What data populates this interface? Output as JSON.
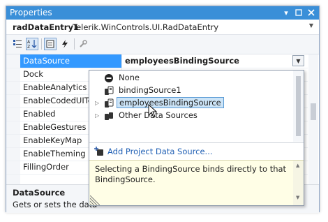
{
  "window": {
    "title": "Properties"
  },
  "object_selector": {
    "name": "radDataEntry1",
    "type": "Telerik.WinControls.UI.RadDataEntry"
  },
  "toolbar": {
    "buttons": [
      "categorized-icon",
      "alphabetical-icon",
      "properties-icon",
      "events-icon",
      "property-pages-icon"
    ]
  },
  "properties": [
    {
      "name": "DataSource",
      "value": "employeesBindingSource"
    },
    {
      "name": "Dock",
      "value": ""
    },
    {
      "name": "EnableAnalytics",
      "value": ""
    },
    {
      "name": "EnableCodedUITe",
      "value": ""
    },
    {
      "name": "Enabled",
      "value": ""
    },
    {
      "name": "EnableGestures",
      "value": ""
    },
    {
      "name": "EnableKeyMap",
      "value": ""
    },
    {
      "name": "EnableTheming",
      "value": ""
    },
    {
      "name": "FillingOrder",
      "value": ""
    }
  ],
  "dropdown": {
    "items": [
      {
        "label": "None"
      },
      {
        "label": "bindingSource1"
      },
      {
        "label": "employeesBindingSource"
      },
      {
        "label": "Other Data Sources"
      }
    ],
    "add_link": "Add Project Data Source...",
    "hint": "Selecting a BindingSource binds directly to that BindingSource."
  },
  "description": {
    "title": "DataSource",
    "text": "Gets or sets the data"
  },
  "colors": {
    "titlebar": "#3a8fd8",
    "selection": "#3399ff",
    "hint_bg": "#fffee6",
    "link": "#1f5fb4"
  }
}
